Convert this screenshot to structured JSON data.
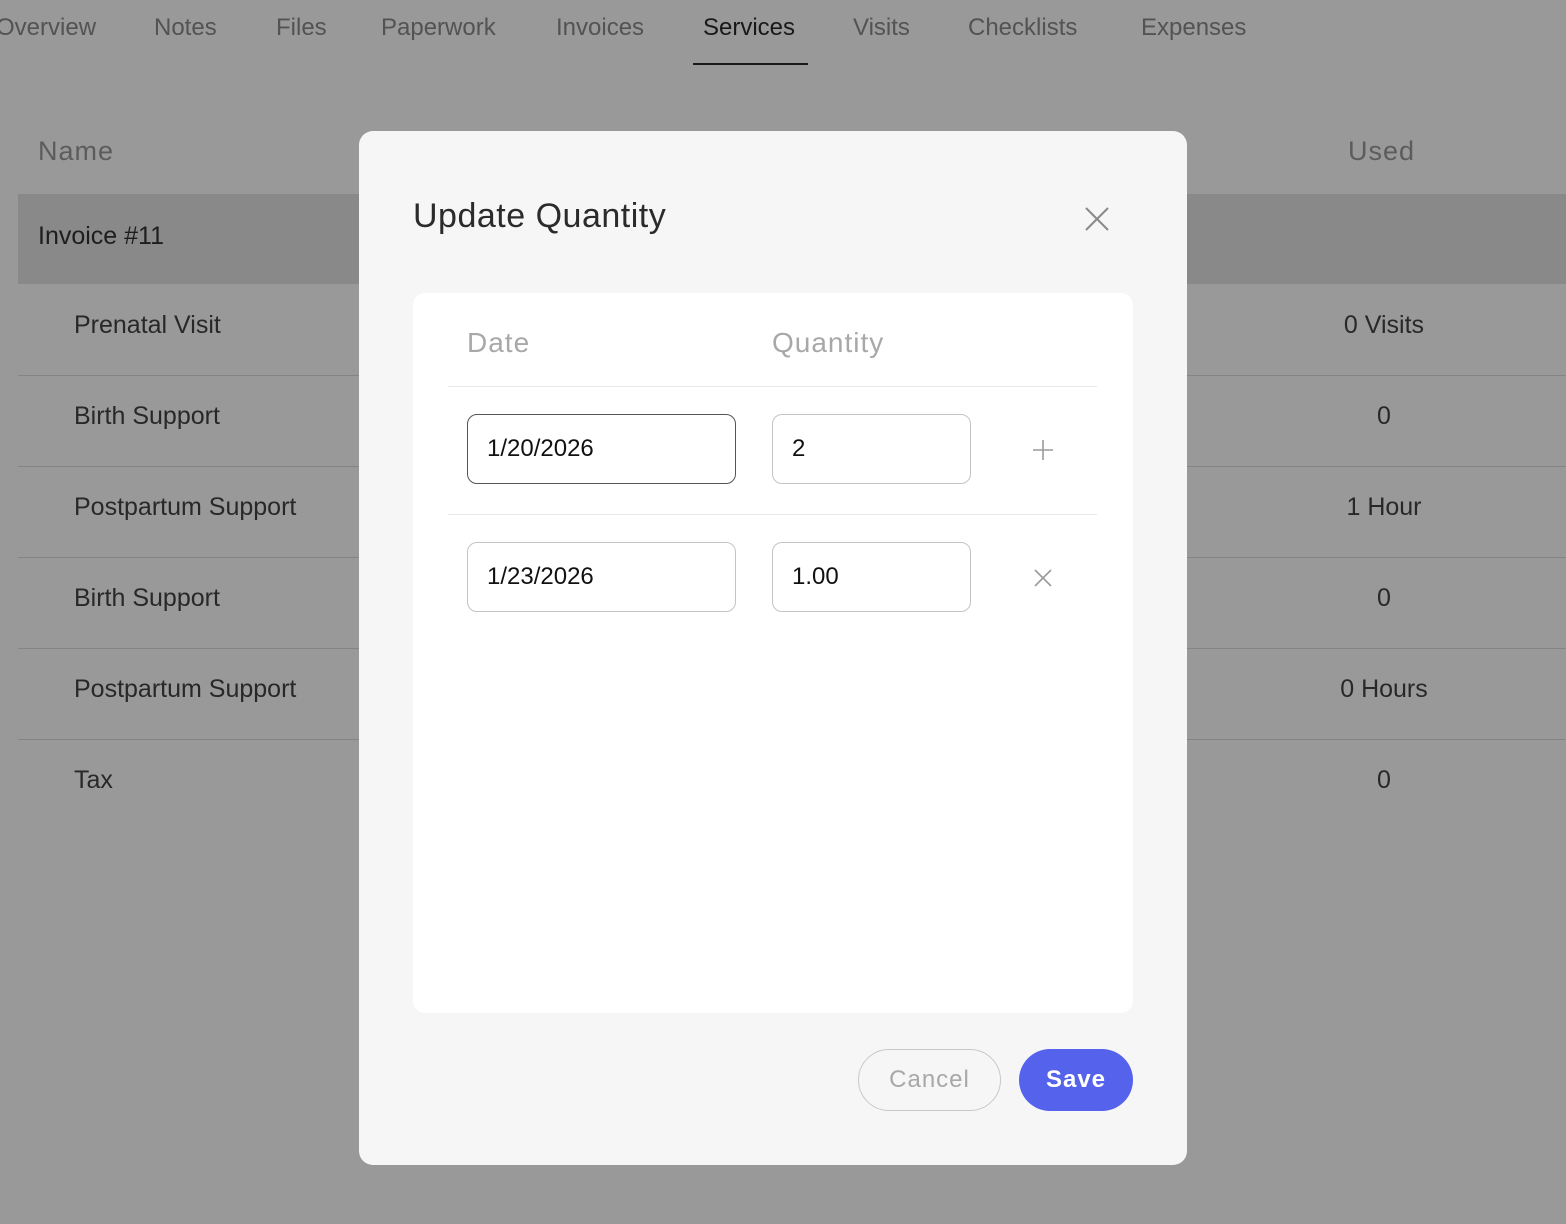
{
  "tabs": [
    "Overview",
    "Notes",
    "Files",
    "Paperwork",
    "Invoices",
    "Services",
    "Visits",
    "Checklists",
    "Expenses"
  ],
  "active_tab": "Services",
  "table": {
    "headers": {
      "name": "Name",
      "used": "Used"
    },
    "group": "Invoice #11",
    "rows": [
      {
        "name": "Prenatal Visit",
        "used": "0 Visits"
      },
      {
        "name": "Birth Support",
        "used": "0"
      },
      {
        "name": "Postpartum Support",
        "used": "1 Hour"
      },
      {
        "name": "Birth Support",
        "used": "0"
      },
      {
        "name": "Postpartum Support",
        "used": "0 Hours"
      },
      {
        "name": "Tax",
        "used": "0"
      }
    ]
  },
  "modal": {
    "title": "Update Quantity",
    "columns": {
      "date": "Date",
      "quantity": "Quantity"
    },
    "entries": [
      {
        "date": "1/20/2026",
        "quantity": "2",
        "action_icon": "plus-icon"
      },
      {
        "date": "1/23/2026",
        "quantity": "1.00",
        "action_icon": "close-icon"
      }
    ],
    "cancel_label": "Cancel",
    "save_label": "Save"
  },
  "colors": {
    "accent": "#5563ec"
  }
}
